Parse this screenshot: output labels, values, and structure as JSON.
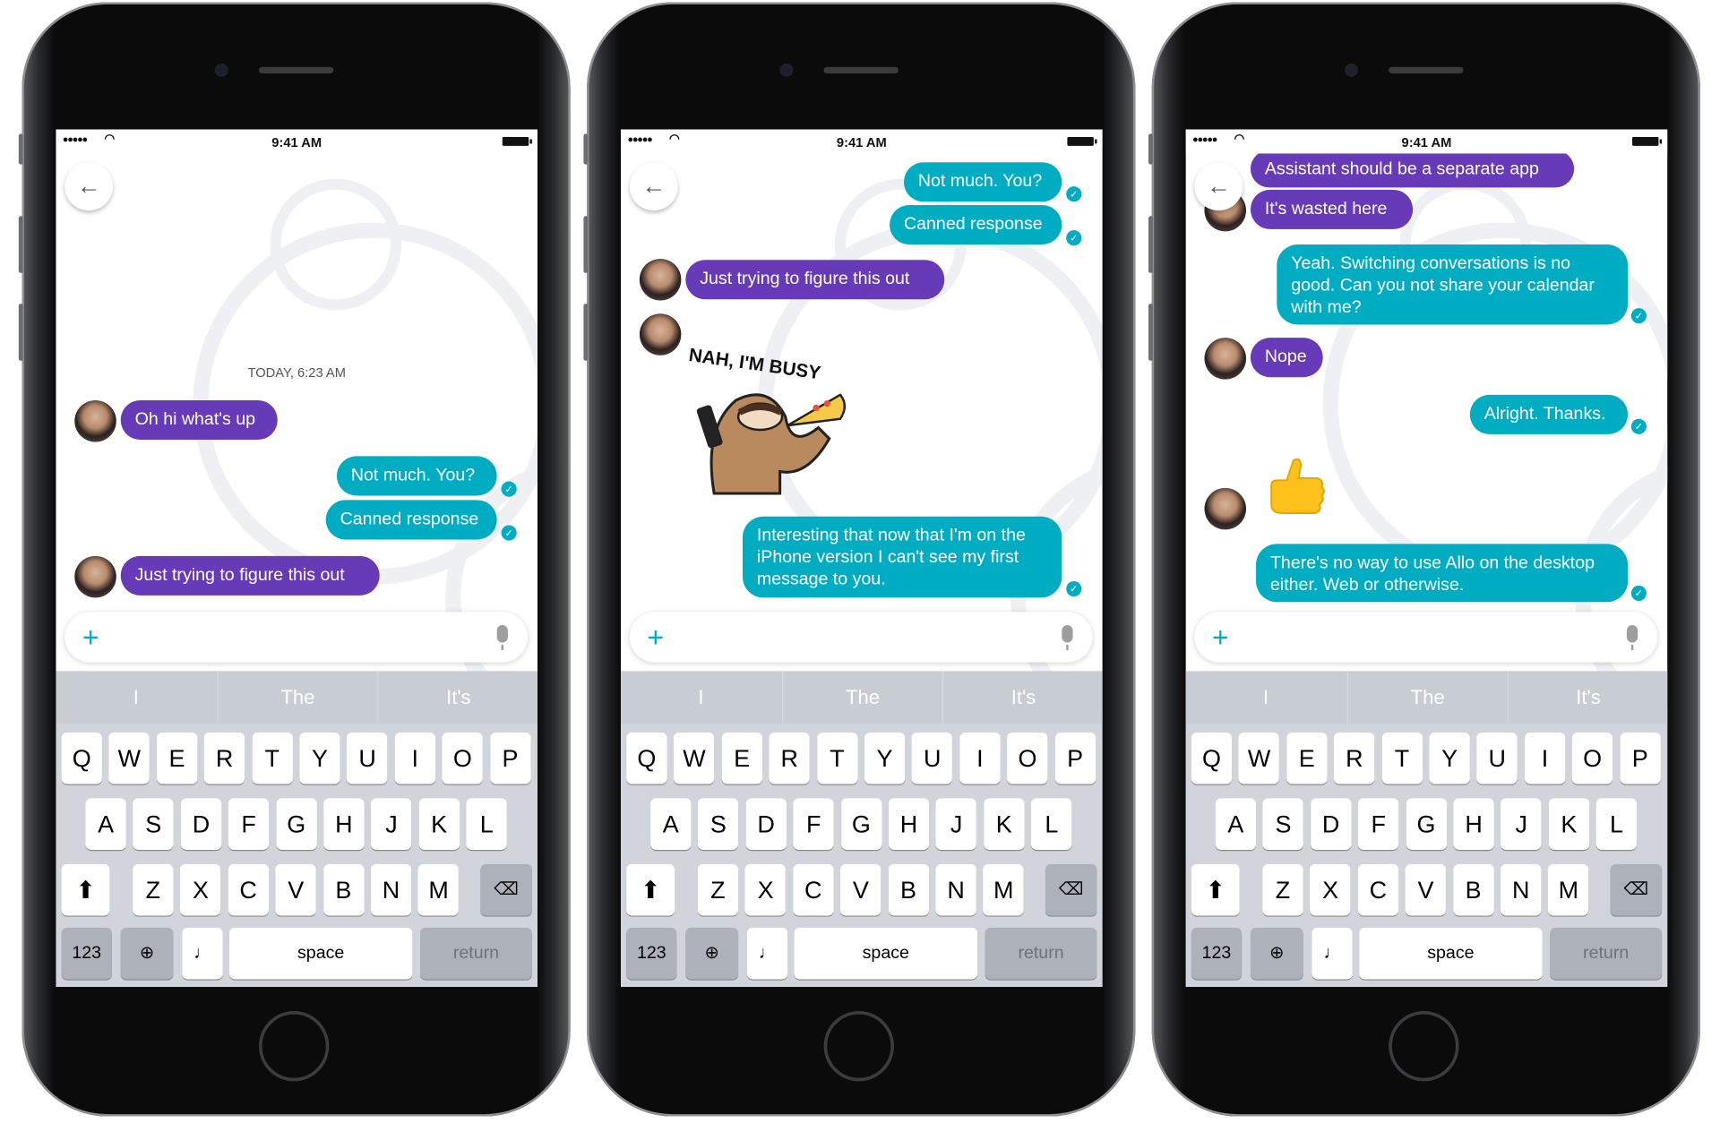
{
  "colors": {
    "incoming_bubble": "#673ab7",
    "outgoing_bubble": "#00acc1",
    "keyboard_bg": "#d1d5db"
  },
  "status_bar": {
    "time": "9:41 AM",
    "signal": "●●●●●",
    "wifi_icon": "wifi-icon",
    "battery_icon": "battery-full-icon"
  },
  "keyboard": {
    "suggestions": [
      "I",
      "The",
      "It's"
    ],
    "row1": [
      "Q",
      "W",
      "E",
      "R",
      "T",
      "Y",
      "U",
      "I",
      "O",
      "P"
    ],
    "row2": [
      "A",
      "S",
      "D",
      "F",
      "G",
      "H",
      "J",
      "K",
      "L"
    ],
    "row3": [
      "Z",
      "X",
      "C",
      "V",
      "B",
      "N",
      "M"
    ],
    "numbers_label": "123",
    "space_label": "space",
    "return_label": "return"
  },
  "phones": [
    {
      "timestamp": "TODAY, 6:23 AM",
      "messages": [
        {
          "type": "text",
          "from": "them",
          "text": "Oh hi what's up"
        },
        {
          "type": "text",
          "from": "me",
          "text": "Not much. You?",
          "read": true
        },
        {
          "type": "text",
          "from": "me",
          "text": "Canned response",
          "read": true
        },
        {
          "type": "text",
          "from": "them",
          "text": "Just trying to figure this out"
        }
      ]
    },
    {
      "messages": [
        {
          "type": "text",
          "from": "me",
          "text": "Not much. You?",
          "read": true
        },
        {
          "type": "text",
          "from": "me",
          "text": "Canned response",
          "read": true
        },
        {
          "type": "text",
          "from": "them",
          "text": "Just trying to figure this out"
        },
        {
          "type": "sticker",
          "from": "them",
          "caption": "NAH, I'M BUSY"
        },
        {
          "type": "text",
          "from": "me",
          "text": "Interesting that now that I'm on the\niPhone version I can't see my first\nmessage to you.",
          "read": true
        }
      ]
    },
    {
      "messages": [
        {
          "type": "text",
          "from": "them",
          "text": "Assistant should be a separate app"
        },
        {
          "type": "text",
          "from": "them",
          "text": "It's wasted here"
        },
        {
          "type": "text",
          "from": "me",
          "text": "Yeah. Switching conversations is no\ngood. Can you not share your calendar\nwith me?",
          "read": true
        },
        {
          "type": "text",
          "from": "them",
          "text": "Nope"
        },
        {
          "type": "text",
          "from": "me",
          "text": "Alright. Thanks.",
          "read": true
        },
        {
          "type": "emoji",
          "from": "them",
          "emoji": "thumbs-up"
        },
        {
          "type": "text",
          "from": "me",
          "text": "There's no way to use Allo on the desktop\neither. Web or otherwise.",
          "read": true
        }
      ]
    }
  ]
}
